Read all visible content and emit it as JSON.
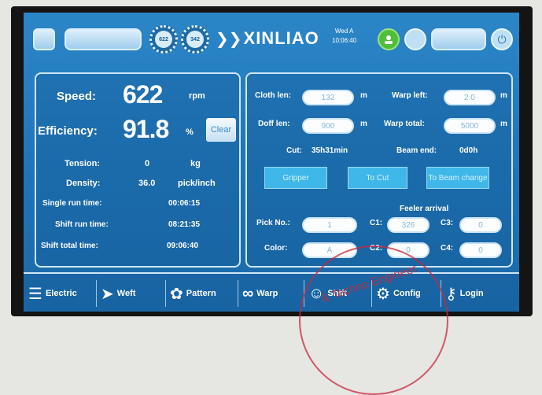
{
  "header": {
    "gauge1_value": "622",
    "gauge2_value": "342",
    "brand": "XINLIAO",
    "day": "Wed A",
    "time": "10:06:40"
  },
  "left": {
    "speed_label": "Speed:",
    "speed_value": "622",
    "speed_unit": "rpm",
    "efficiency_label": "Efficiency:",
    "efficiency_value": "91.8",
    "efficiency_unit": "%",
    "clear_label": "Clear",
    "tension_label": "Tension:",
    "tension_value": "0",
    "tension_unit": "kg",
    "density_label": "Density:",
    "density_value": "36.0",
    "density_unit": "pick/inch",
    "single_run_label": "Single run time:",
    "single_run_value": "00:06:15",
    "shift_run_label": "Shift run time:",
    "shift_run_value": "08:21:35",
    "shift_total_label": "Shift total time:",
    "shift_total_value": "09:06:40"
  },
  "right": {
    "cloth_len_label": "Cloth len:",
    "cloth_len_value": "132",
    "cloth_len_unit": "m",
    "warp_left_label": "Warp left:",
    "warp_left_value": "2.0",
    "warp_left_unit": "m",
    "doff_len_label": "Doff len:",
    "doff_len_value": "900",
    "doff_len_unit": "m",
    "warp_total_label": "Warp total:",
    "warp_total_value": "5000",
    "warp_total_unit": "m",
    "cut_label": "Cut:",
    "cut_value": "35h31min",
    "beam_end_label": "Beam end:",
    "beam_end_value": "0d0h",
    "btn1": "Gripper",
    "btn2": "To Cut",
    "btn3": "To Beam change",
    "feeler_title": "Feeler arrival",
    "pick_no_label": "Pick No.:",
    "pick_no_value": "1",
    "c1_label": "C1:",
    "c1_value": "326",
    "c3_label": "C3:",
    "c3_value": "0",
    "color_label": "Color:",
    "color_value": "A",
    "c2_label": "C2:",
    "c2_value": "0",
    "c4_label": "C4:",
    "c4_value": "0"
  },
  "nav": [
    {
      "label": "Electric",
      "icon": "sliders-icon"
    },
    {
      "label": "Weft",
      "icon": "weft-arrow-icon"
    },
    {
      "label": "Pattern",
      "icon": "palette-icon"
    },
    {
      "label": "Warp",
      "icon": "warp-rollers-icon"
    },
    {
      "label": "Shift",
      "icon": "people-icon"
    },
    {
      "label": "Config",
      "icon": "gears-icon"
    },
    {
      "label": "Login",
      "icon": "key-icon"
    }
  ],
  "stamp": {
    "text": "& Techno Engineer"
  },
  "colors": {
    "screen": "#2b86c8",
    "button": "#3fb7e8",
    "status_green": "#4fbf3a"
  }
}
